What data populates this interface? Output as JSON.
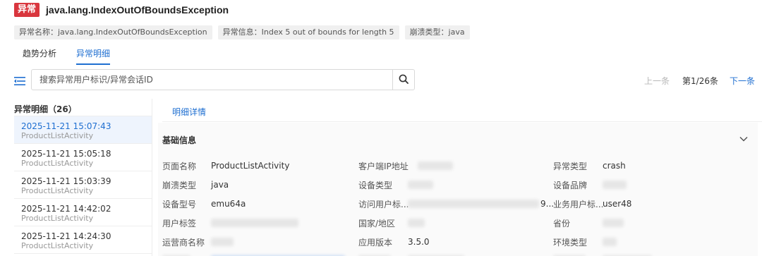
{
  "header": {
    "badge": "异常",
    "title": "java.lang.IndexOutOfBoundsException"
  },
  "tags": [
    "异常名称：java.lang.IndexOutOfBoundsException",
    "异常信息：Index 5 out of bounds for length 5",
    "崩溃类型：java"
  ],
  "tabs": [
    "趋势分析",
    "异常明细"
  ],
  "search": {
    "placeholder": "搜索异常用户标识/异常会话ID"
  },
  "pager": {
    "prev": "上一条",
    "page": "第1/26条",
    "next": "下一条"
  },
  "list": {
    "title": "异常明细（26）",
    "items": [
      {
        "time": "2025-11-21 15:07:43",
        "activity": "ProductListActivity"
      },
      {
        "time": "2025-11-21 15:05:18",
        "activity": "ProductListActivity"
      },
      {
        "time": "2025-11-21 15:03:39",
        "activity": "ProductListActivity"
      },
      {
        "time": "2025-11-21 14:42:02",
        "activity": "ProductListActivity"
      },
      {
        "time": "2025-11-21 14:24:30",
        "activity": "ProductListActivity"
      }
    ]
  },
  "detail": {
    "tab": "明细详情",
    "section": "基础信息",
    "fields": {
      "page_name": {
        "label": "页面名称",
        "value": "ProductListActivity"
      },
      "client_ip": {
        "label": "客户端IP地址",
        "value": ""
      },
      "exception_type": {
        "label": "异常类型",
        "value": "crash"
      },
      "crash_type": {
        "label": "崩溃类型",
        "value": "java"
      },
      "device_type": {
        "label": "设备类型",
        "value": ""
      },
      "device_brand": {
        "label": "设备品牌",
        "value": ""
      },
      "device_model": {
        "label": "设备型号",
        "value": "emu64a"
      },
      "visit_user": {
        "label": "访问用户标...",
        "value": "9..."
      },
      "biz_user": {
        "label": "业务用户标...",
        "value": "user48"
      },
      "user_tag": {
        "label": "用户标签",
        "value": ""
      },
      "country": {
        "label": "国家/地区",
        "value": ""
      },
      "province": {
        "label": "省份",
        "value": ""
      },
      "carrier": {
        "label": "运营商名称",
        "value": ""
      },
      "app_version": {
        "label": "应用版本",
        "value": "3.5.0"
      },
      "env_type": {
        "label": "环境类型",
        "value": ""
      }
    }
  },
  "colors": {
    "accent": "#1f6fd1",
    "badge": "#d9363e"
  }
}
